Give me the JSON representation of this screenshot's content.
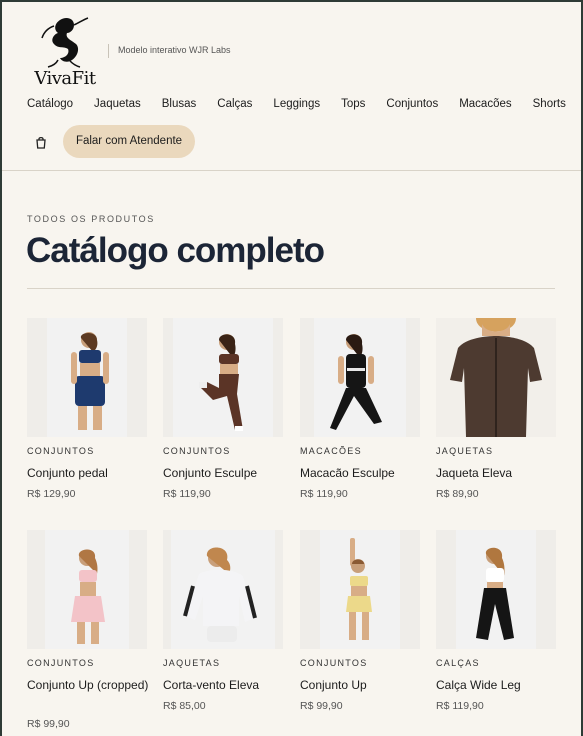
{
  "brand": {
    "name": "VivaFit",
    "tagline": "Modelo interativo WJR Labs",
    "logo_icon": "woman-silhouette-logo"
  },
  "nav": {
    "items": [
      "Catálogo",
      "Jaquetas",
      "Blusas",
      "Calças",
      "Leggings",
      "Tops",
      "Conjuntos",
      "Macacões",
      "Shorts"
    ]
  },
  "header": {
    "cart_icon": "shopping-bag-icon",
    "cta": "Falar com Atendente"
  },
  "section": {
    "eyebrow": "TODOS OS PRODUTOS",
    "title": "Catálogo completo"
  },
  "products": [
    {
      "category": "CONJUNTOS",
      "name": "Conjunto pedal",
      "price": "R$ 129,90"
    },
    {
      "category": "CONJUNTOS",
      "name": "Conjunto Esculpe",
      "price": "R$ 119,90"
    },
    {
      "category": "MACACÕES",
      "name": "Macacão Esculpe",
      "price": "R$ 119,90"
    },
    {
      "category": "JAQUETAS",
      "name": "Jaqueta Eleva",
      "price": "R$ 89,90"
    },
    {
      "category": "CONJUNTOS",
      "name": "Conjunto Up (cropped)",
      "price": "R$ 99,90"
    },
    {
      "category": "JAQUETAS",
      "name": "Corta-vento Eleva",
      "price": "R$ 85,00"
    },
    {
      "category": "CONJUNTOS",
      "name": "Conjunto Up",
      "price": "R$ 99,90"
    },
    {
      "category": "CALÇAS",
      "name": "Calça Wide Leg",
      "price": "R$ 119,90"
    }
  ],
  "colors": {
    "background": "#f8f5ef",
    "accent": "#ead8bd",
    "title": "#1c2536"
  }
}
